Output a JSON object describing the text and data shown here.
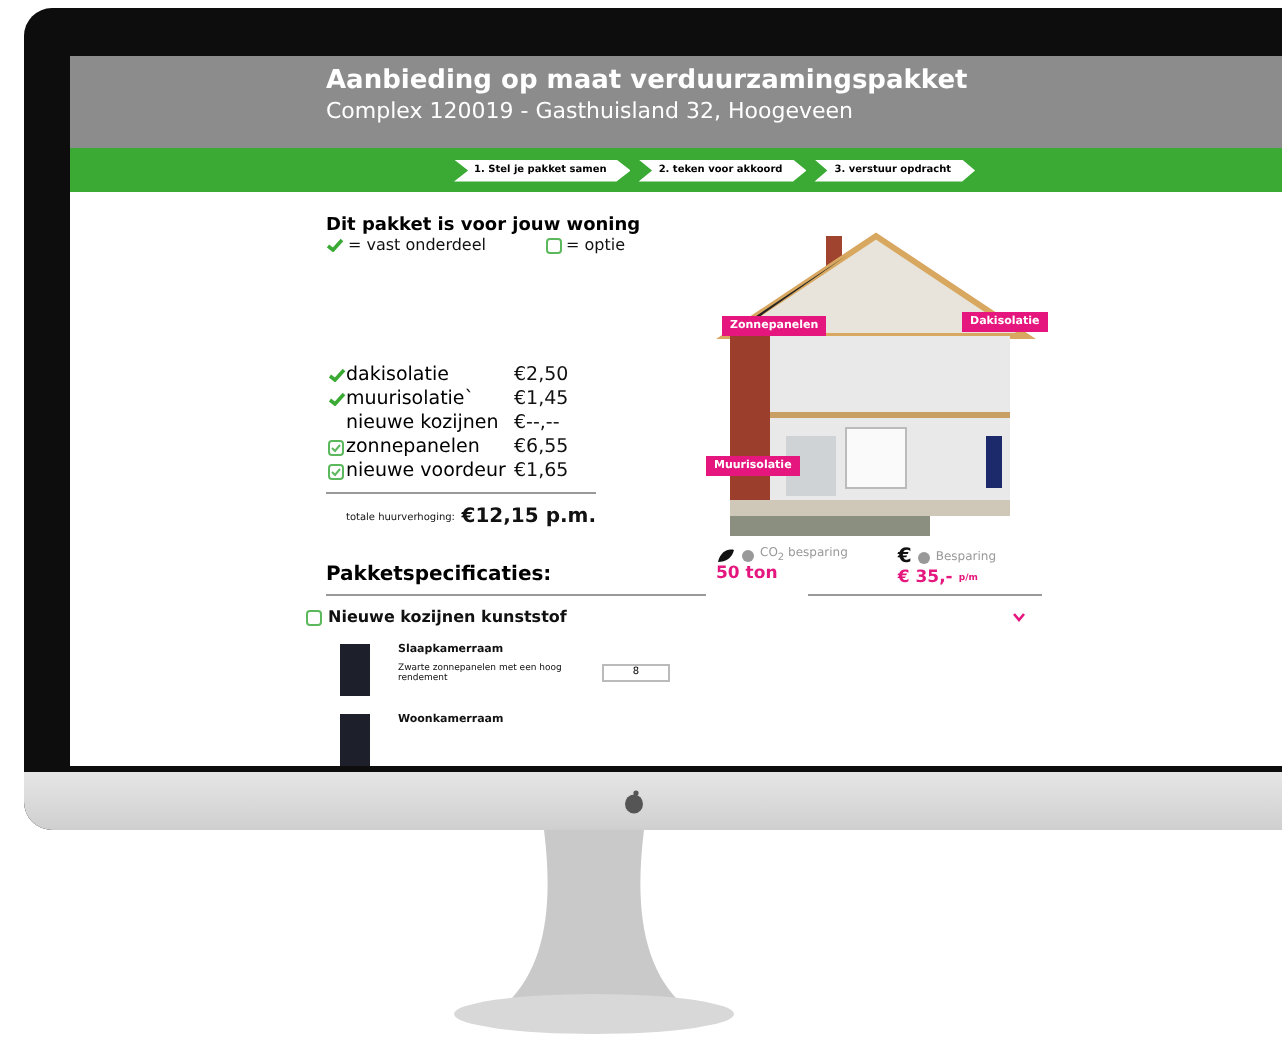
{
  "header": {
    "title": "Aanbieding op maat verduurzamingspakket",
    "subtitle": "Complex 120019 - Gasthuisland 32, Hoogeveen"
  },
  "steps": [
    "1. Stel je pakket samen",
    "2. teken voor akkoord",
    "3. verstuur opdracht"
  ],
  "package": {
    "title": "Dit pakket is voor jouw woning",
    "legend_fixed": "= vast onderdeel",
    "legend_option": "= optie",
    "items": [
      {
        "kind": "fixed",
        "label": "dakisolatie",
        "price": "€2,50"
      },
      {
        "kind": "fixed",
        "label": "muurisolatie`",
        "price": "€1,45"
      },
      {
        "kind": "none",
        "label": "nieuwe kozijnen",
        "price": "€--,--"
      },
      {
        "kind": "option",
        "checked": true,
        "label": "zonnepanelen",
        "price": "€6,55"
      },
      {
        "kind": "option",
        "checked": true,
        "label": "nieuwe voordeur",
        "price": "€1,65"
      }
    ],
    "total_label": "totale huurverhoging:",
    "total": "€12,15 p.m."
  },
  "house_labels": [
    "Zonnepanelen",
    "Dakisolatie",
    "Muurisolatie"
  ],
  "stats": [
    {
      "kind": "co2",
      "label": "CO$_{2}$ besparing",
      "value": "50 ton"
    },
    {
      "kind": "money",
      "symbol": "€",
      "label": "Besparing",
      "value": "€ 35,-",
      "unit": "p/m"
    }
  ],
  "specs": {
    "title": "Pakketspecificaties:",
    "option": {
      "label": "Nieuwe kozijnen kunststof",
      "checked": false,
      "expanded": false
    },
    "products": [
      {
        "name": "Slaapkamerraam",
        "description": "Zwarte zonnepanelen met een hoog rendement",
        "quantity": "8"
      },
      {
        "name": "Woonkamerraam"
      }
    ]
  }
}
